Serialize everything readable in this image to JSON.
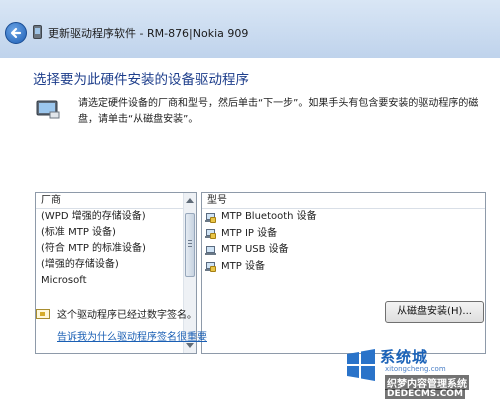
{
  "window": {
    "title": "更新驱动程序软件 - RM-876|Nokia 909"
  },
  "page": {
    "heading": "选择要为此硬件安装的设备驱动程序",
    "instruction": "请选定硬件设备的厂商和型号，然后单击“下一步”。如果手头有包含要安装的驱动程序的磁盘，请单击“从磁盘安装”。"
  },
  "manufacturer_list": {
    "header": "厂商",
    "items": [
      {
        "label": "(WPD 增强的存储设备)"
      },
      {
        "label": "(标准 MTP 设备)"
      },
      {
        "label": "(符合 MTP 的标准设备)"
      },
      {
        "label": "(增强的存储设备)"
      },
      {
        "label": "Microsoft"
      }
    ]
  },
  "model_list": {
    "header": "型号",
    "items": [
      {
        "label": "MTP Bluetooth 设备",
        "icon": "certificate-device-icon"
      },
      {
        "label": "MTP IP 设备",
        "icon": "certificate-device-icon"
      },
      {
        "label": "MTP USB 设备",
        "icon": "device-icon"
      },
      {
        "label": "MTP 设备",
        "icon": "certificate-device-icon"
      }
    ]
  },
  "signature": {
    "status": "这个驱动程序已经过数字签名。",
    "link": "告诉我为什么驱动程序签名很重要"
  },
  "buttons": {
    "have_disk": "从磁盘安装(H)..."
  },
  "watermark": {
    "name": "系统城",
    "small": "xitongcheng.com",
    "tagline": "织梦内容管理系统",
    "url": "DEDECMS.COM"
  },
  "colors": {
    "heading": "#1f3f8c",
    "link": "#1a5fb4",
    "titlebar": "#cddcf0"
  }
}
